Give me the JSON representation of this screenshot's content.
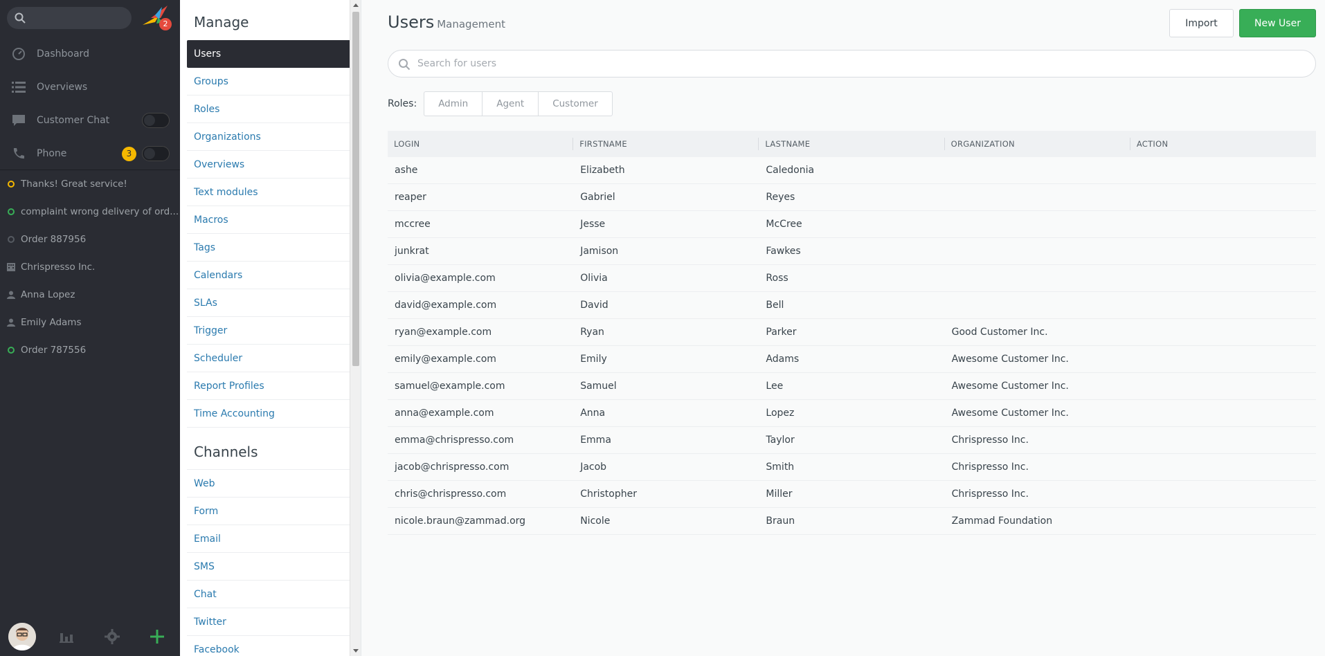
{
  "nav": {
    "search_placeholder": "",
    "logo_badge": "2",
    "items": [
      {
        "label": "Dashboard",
        "icon": "dashboard-icon"
      },
      {
        "label": "Overviews",
        "icon": "list-icon"
      },
      {
        "label": "Customer Chat",
        "icon": "chat-icon"
      },
      {
        "label": "Phone",
        "icon": "phone-icon",
        "count": "3"
      }
    ],
    "tasks": [
      {
        "label": "Thanks! Great service!",
        "icon": "status-dot-icon",
        "color": "#f5b800"
      },
      {
        "label": "complaint wrong delivery of ord...",
        "icon": "status-dot-icon",
        "color": "#38ae57"
      },
      {
        "label": "Order 887956",
        "icon": "status-dot-icon",
        "color": "#555a61"
      },
      {
        "label": "Chrispresso Inc.",
        "icon": "organization-icon"
      },
      {
        "label": "Anna Lopez",
        "icon": "user-icon"
      },
      {
        "label": "Emily Adams",
        "icon": "user-icon"
      },
      {
        "label": "Order 787556",
        "icon": "status-dot-icon",
        "color": "#38ae57"
      }
    ]
  },
  "menu": {
    "manage_heading": "Manage",
    "manage_items": [
      "Users",
      "Groups",
      "Roles",
      "Organizations",
      "Overviews",
      "Text modules",
      "Macros",
      "Tags",
      "Calendars",
      "SLAs",
      "Trigger",
      "Scheduler",
      "Report Profiles",
      "Time Accounting"
    ],
    "channels_heading": "Channels",
    "channel_items": [
      "Web",
      "Form",
      "Email",
      "SMS",
      "Chat",
      "Twitter",
      "Facebook"
    ]
  },
  "main": {
    "title": "Users",
    "subtitle": "Management",
    "import_label": "Import",
    "new_user_label": "New User",
    "search_placeholder": "Search for users",
    "roles_label": "Roles:",
    "roles": [
      "Admin",
      "Agent",
      "Customer"
    ],
    "columns": [
      "LOGIN",
      "FIRSTNAME",
      "LASTNAME",
      "ORGANIZATION",
      "ACTION"
    ],
    "rows": [
      [
        "ashe",
        "Elizabeth",
        "Caledonia",
        "",
        ""
      ],
      [
        "reaper",
        "Gabriel",
        "Reyes",
        "",
        ""
      ],
      [
        "mccree",
        "Jesse",
        "McCree",
        "",
        ""
      ],
      [
        "junkrat",
        "Jamison",
        "Fawkes",
        "",
        ""
      ],
      [
        "olivia@example.com",
        "Olivia",
        "Ross",
        "",
        ""
      ],
      [
        "david@example.com",
        "David",
        "Bell",
        "",
        ""
      ],
      [
        "ryan@example.com",
        "Ryan",
        "Parker",
        "Good Customer Inc.",
        ""
      ],
      [
        "emily@example.com",
        "Emily",
        "Adams",
        "Awesome Customer Inc.",
        ""
      ],
      [
        "samuel@example.com",
        "Samuel",
        "Lee",
        "Awesome Customer Inc.",
        ""
      ],
      [
        "anna@example.com",
        "Anna",
        "Lopez",
        "Awesome Customer Inc.",
        ""
      ],
      [
        "emma@chrispresso.com",
        "Emma",
        "Taylor",
        "Chrispresso Inc.",
        ""
      ],
      [
        "jacob@chrispresso.com",
        "Jacob",
        "Smith",
        "Chrispresso Inc.",
        ""
      ],
      [
        "chris@chrispresso.com",
        "Christopher",
        "Miller",
        "Chrispresso Inc.",
        ""
      ],
      [
        "nicole.braun@zammad.org",
        "Nicole",
        "Braun",
        "Zammad Foundation",
        ""
      ]
    ]
  }
}
